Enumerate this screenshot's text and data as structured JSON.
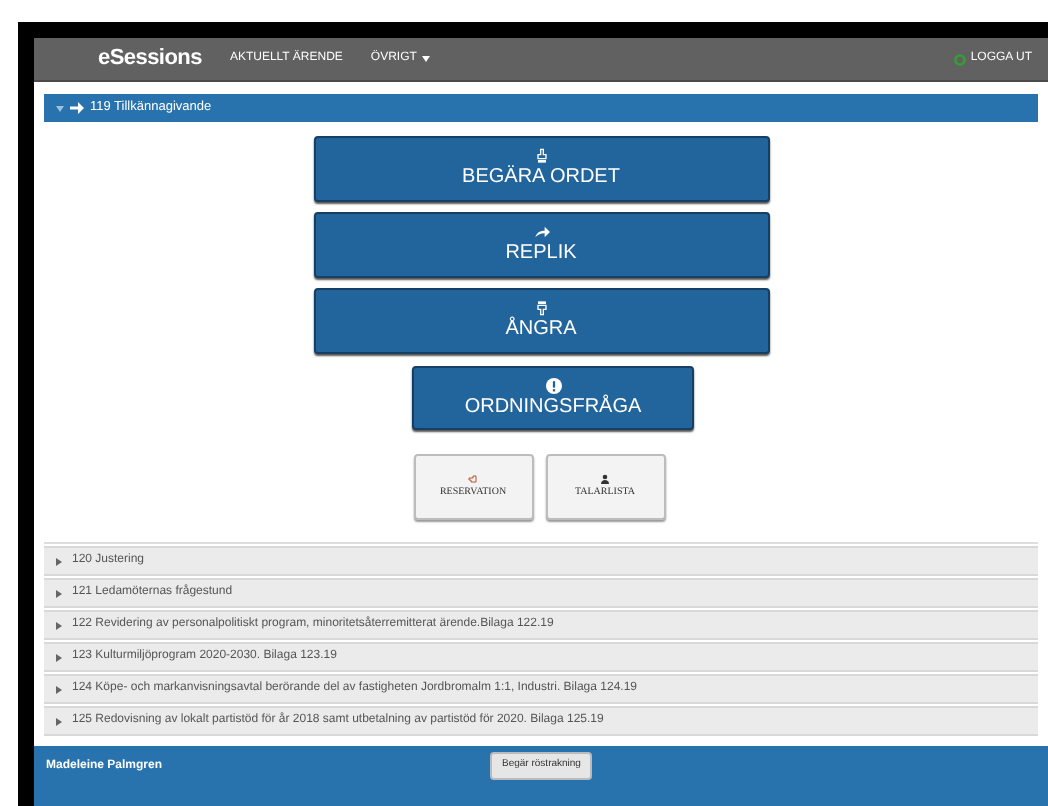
{
  "navbar": {
    "brand": "eSessions",
    "menu": [
      {
        "label": "AKTUELLT ÄRENDE",
        "dropdown": false
      },
      {
        "label": "ÖVRIGT",
        "dropdown": true
      }
    ],
    "logout": "LOGGA UT"
  },
  "current_item": {
    "title": "119 Tillkännagivande",
    "expanded": true
  },
  "actions": [
    {
      "label": "BEGÄRA ORDET",
      "kind": "request"
    },
    {
      "label": "REPLIK",
      "kind": "reply"
    },
    {
      "label": "ÅNGRA",
      "kind": "undo"
    },
    {
      "label": "ORDNINGSFRÅGA",
      "kind": "order"
    }
  ],
  "small_actions": [
    {
      "label": "RESERVATION",
      "kind": "reservation"
    },
    {
      "label": "TALARLISTA",
      "kind": "speakers"
    }
  ],
  "agenda": [
    {
      "title": "120 Justering",
      "expanded": false
    },
    {
      "title": "121 Ledamöternas frågestund",
      "expanded": false
    },
    {
      "title": "122 Revidering av personalpolitiskt program, minoritetsåterremitterat ärende.Bilaga 122.19",
      "expanded": false
    },
    {
      "title": "123 Kulturmiljöprogram 2020-2030. Bilaga 123.19",
      "expanded": false
    },
    {
      "title": "124 Köpe- och markanvisningsavtal berörande del av fastigheten Jordbromalm 1:1, Industri. Bilaga 124.19",
      "expanded": false
    },
    {
      "title": "125 Redovisning av lokalt partistöd för år 2018 samt utbetalning av partistöd för 2020. Bilaga 125.19",
      "expanded": false
    }
  ],
  "footer": {
    "user": "Madeleine Palmgren",
    "button": "Begär röstrakning"
  }
}
